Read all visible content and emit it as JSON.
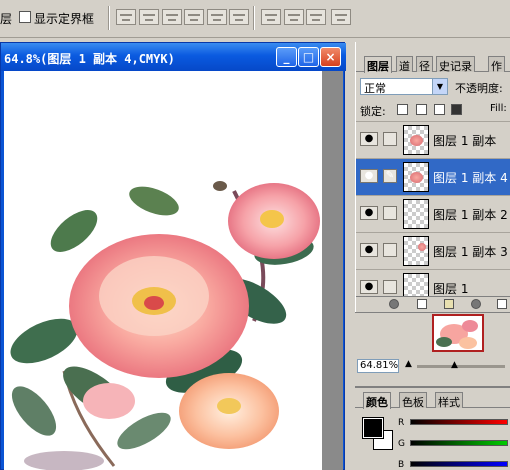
{
  "options_bar": {
    "layer_label": "层",
    "show_bounds_label": "显示定界框"
  },
  "document": {
    "title": "64.8%(图层 1 副本 4,CMYK)",
    "minimize": "_",
    "maximize": "□",
    "close": "×"
  },
  "layers_palette": {
    "tabs": [
      "图层",
      "道",
      "径",
      "史记录",
      "作"
    ],
    "blend_mode": "正常",
    "opacity_label": "不透明度:",
    "lock_label": "锁定:",
    "fill_label": "Fill:",
    "layers": [
      {
        "name": "图层 1 副本",
        "selected": false
      },
      {
        "name": "图层 1 副本 4",
        "selected": true
      },
      {
        "name": "图层 1 副本 2",
        "selected": false
      },
      {
        "name": "图层 1 副本 3",
        "selected": false
      },
      {
        "name": "图层 1",
        "selected": false
      }
    ]
  },
  "navigator": {
    "zoom": "64.81%"
  },
  "color_palette": {
    "tabs": [
      "颜色",
      "色板",
      "样式"
    ],
    "channels": [
      "R",
      "G",
      "B"
    ],
    "foreground": "#000000",
    "background": "#ffffff"
  },
  "colors": {
    "title_bar": "#0a5ae0",
    "selection": "#3169c6",
    "panel": "#d4d0c8"
  }
}
